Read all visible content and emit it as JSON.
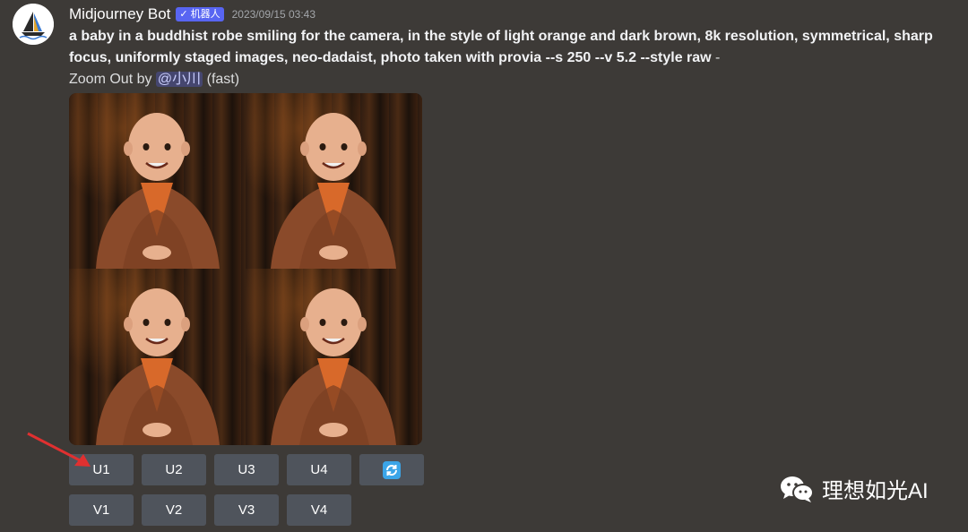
{
  "message": {
    "author": "Midjourney Bot",
    "bot_tag": "机器人",
    "timestamp": "2023/09/15 03:43",
    "prompt": "a baby in a buddhist robe smiling for the camera, in the style of light orange and dark brown, 8k resolution, symmetrical, sharp focus, uniformly staged images, neo-dadaist, photo taken with provia --s 250 --v 5.2 --style raw",
    "prompt_suffix": " -",
    "meta_prefix": "Zoom Out by ",
    "mention": "@小川",
    "meta_suffix": " (fast)"
  },
  "image_grid": {
    "description_icon": "image-grid",
    "cells": 4
  },
  "buttons": {
    "row1": [
      "U1",
      "U2",
      "U3",
      "U4"
    ],
    "reroll_icon": "refresh-icon",
    "row2": [
      "V1",
      "V2",
      "V3",
      "V4"
    ]
  },
  "watermark": {
    "icon": "wechat-icon",
    "text": "理想如光AI"
  },
  "colors": {
    "background": "#3d3a37",
    "button": "#4f545c",
    "bot_tag": "#5865f2",
    "arrow": "#e03030",
    "reroll": "#3ba5e8"
  }
}
